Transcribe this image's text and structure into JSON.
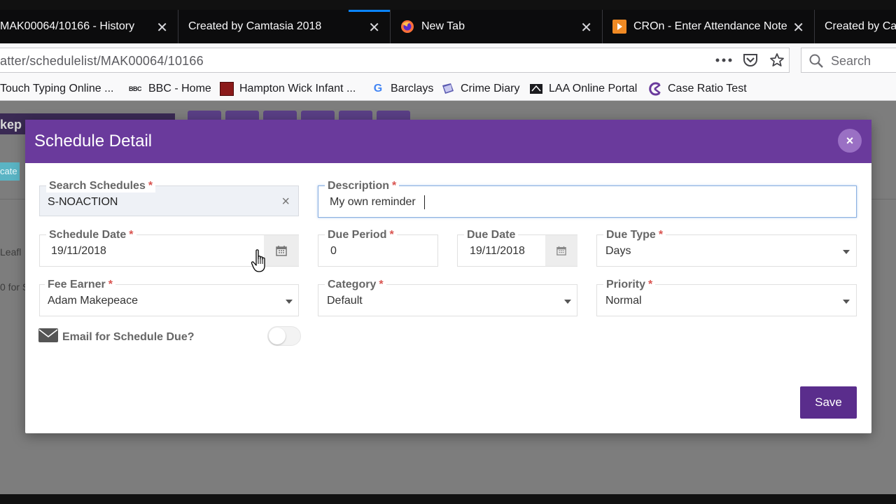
{
  "browser": {
    "tabs": [
      {
        "title": "MAK00064/10166 - History",
        "close": "✕"
      },
      {
        "title": "Created by Camtasia 2018",
        "close": "✕"
      },
      {
        "title": "New Tab",
        "close": "✕"
      },
      {
        "title": "CROn - Enter Attendance Note",
        "close": "✕"
      },
      {
        "title": "Created by Ca"
      }
    ],
    "url": "atter/schedulelist/MAK00064/10166",
    "search_placeholder": "Search",
    "bookmarks": [
      {
        "label": "Touch Typing Online ..."
      },
      {
        "label": "BBC - Home",
        "icon_text": "BBC"
      },
      {
        "label": "Hampton Wick Infant ..."
      },
      {
        "label": "Barclays",
        "icon_text": "G"
      },
      {
        "label": "Crime Diary"
      },
      {
        "label": "LAA Online Portal"
      },
      {
        "label": "Case Ratio Test"
      }
    ]
  },
  "page_behind": {
    "header_text": "kep",
    "chip_text": "cate",
    "side_text_1": "Leafl",
    "side_text_2": "0 for S"
  },
  "modal": {
    "title": "Schedule Detail",
    "close_symbol": "×",
    "fields": {
      "search_schedules": {
        "label": "Search Schedules",
        "value": "S-NOACTION",
        "clear": "×"
      },
      "description": {
        "label": "Description",
        "value": "My own reminder"
      },
      "schedule_date": {
        "label": "Schedule Date",
        "value": "19/11/2018"
      },
      "due_period": {
        "label": "Due Period",
        "value": "0"
      },
      "due_date": {
        "label": "Due Date",
        "value": "19/11/2018"
      },
      "due_type": {
        "label": "Due Type",
        "value": "Days"
      },
      "fee_earner": {
        "label": "Fee Earner",
        "value": "Adam Makepeace"
      },
      "category": {
        "label": "Category",
        "value": "Default"
      },
      "priority": {
        "label": "Priority",
        "value": "Normal"
      }
    },
    "required_marker": "*",
    "email_toggle": {
      "label": "Email for Schedule Due?",
      "on": false
    },
    "save_label": "Save"
  },
  "colors": {
    "modal_header": "#6a3a9c",
    "save_button": "#5a2d8c",
    "required": "#d9534f",
    "active_tab_accent": "#0a84ff"
  }
}
